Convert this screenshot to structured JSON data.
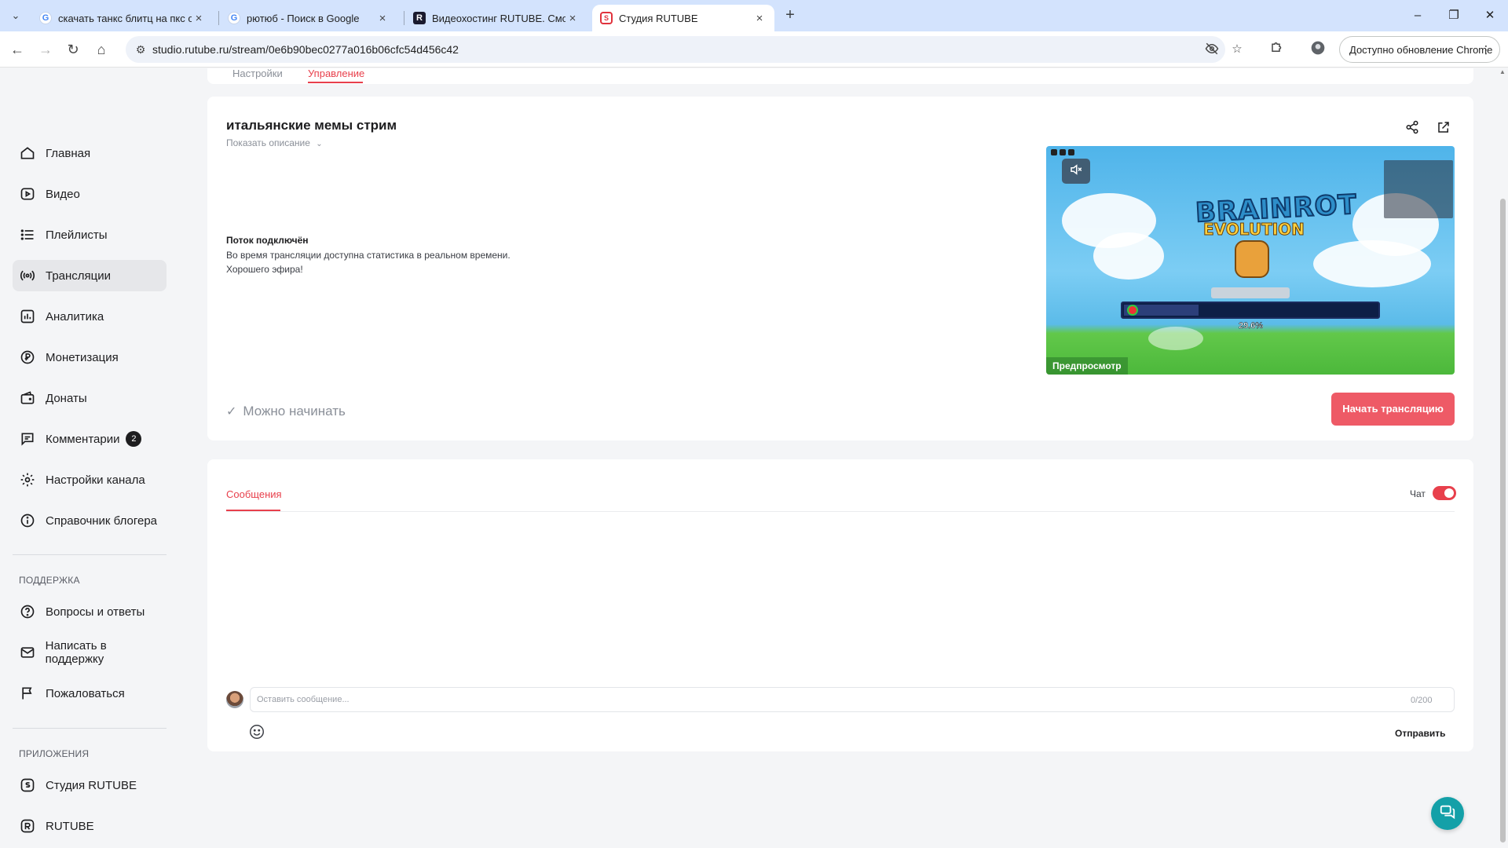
{
  "browser": {
    "tabs": [
      {
        "title": "скачать танкс блитц на пкс оф",
        "favicon": "google-icon",
        "active": false
      },
      {
        "title": "рютюб - Поиск в Google",
        "favicon": "google-icon",
        "active": false
      },
      {
        "title": "Видеохостинг RUTUBE. Смотри",
        "favicon": "rutube-icon",
        "active": false
      },
      {
        "title": "Студия RUTUBE",
        "favicon": "rutube-studio-icon",
        "active": true
      }
    ],
    "url": "studio.rutube.ru/stream/0e6b90bec0277a016b06cfc54d456c42",
    "update_button": "Доступно обновление Chrome"
  },
  "sidebar": {
    "items": [
      {
        "label": "Главная",
        "icon": "home-icon"
      },
      {
        "label": "Видео",
        "icon": "video-icon"
      },
      {
        "label": "Плейлисты",
        "icon": "playlist-icon"
      },
      {
        "label": "Трансляции",
        "icon": "broadcast-icon",
        "active": true
      },
      {
        "label": "Аналитика",
        "icon": "analytics-icon"
      },
      {
        "label": "Монетизация",
        "icon": "ruble-icon"
      },
      {
        "label": "Донаты",
        "icon": "wallet-icon"
      },
      {
        "label": "Комментарии",
        "icon": "comment-icon",
        "badge": "2"
      },
      {
        "label": "Настройки канала",
        "icon": "gear-icon"
      },
      {
        "label": "Справочник блогера",
        "icon": "info-icon"
      }
    ],
    "support_title": "ПОДДЕРЖКА",
    "support_items": [
      {
        "label": "Вопросы и ответы",
        "icon": "question-icon"
      },
      {
        "label": "Написать в поддержку",
        "icon": "mail-icon"
      },
      {
        "label": "Пожаловаться",
        "icon": "flag-icon"
      }
    ],
    "apps_title": "ПРИЛОЖЕНИЯ",
    "apps_items": [
      {
        "label": "Студия RUTUBE",
        "icon": "rutube-studio-icon"
      },
      {
        "label": "RUTUBE",
        "icon": "rutube-icon"
      }
    ]
  },
  "top_tabs": [
    "Настройки",
    "Управление"
  ],
  "stream": {
    "title": "итальянские мемы стрим",
    "show_description": "Показать описание",
    "status_title": "Поток подключён",
    "status_line1": "Во время трансляции доступна статистика в реальном времени.",
    "status_line2": "Хорошего эфира!",
    "ready_text": "Можно начинать",
    "start_button": "Начать трансляцию",
    "preview_label": "Предпросмотр",
    "preview_game": {
      "logo_line1": "BRAINROT",
      "logo_line2": "EVOLUTION",
      "progress_text": "29.6%",
      "progress": 0.296
    }
  },
  "chat": {
    "tab_label": "Сообщения",
    "toggle_label": "Чат",
    "toggle_on": true,
    "input_placeholder": "Оставить сообщение...",
    "counter": "0/200",
    "send_label": "Отправить"
  },
  "colors": {
    "accent": "#e8404c",
    "start_button": "#ee5a66",
    "help_fab": "#14a0a8"
  }
}
